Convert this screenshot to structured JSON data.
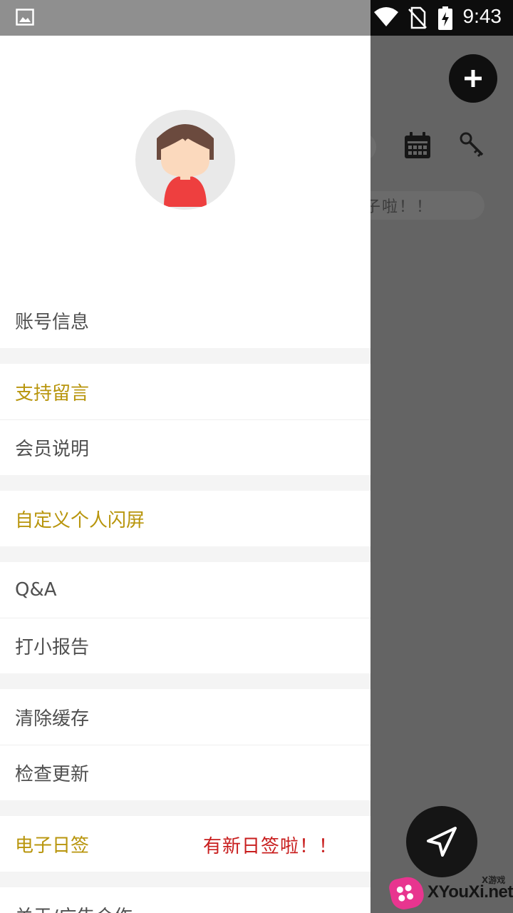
{
  "status_bar": {
    "time": "9:43"
  },
  "background": {
    "banner_text": "子啦！！"
  },
  "drawer": {
    "account": "账号信息",
    "support": "支持留言",
    "member": "会员说明",
    "splash": "自定义个人闪屏",
    "qa": "Q&A",
    "report": "打小报告",
    "clear_cache": "清除缓存",
    "check_update": "检查更新",
    "daily_sign": "电子日签",
    "daily_sign_badge": "有新日签啦！！",
    "about": "关于/广告合作"
  },
  "colors": {
    "gold": "#b8950c",
    "red_badge": "#c81e1e"
  },
  "watermark": {
    "small": "X游戏",
    "text": "XYouXi.net"
  }
}
